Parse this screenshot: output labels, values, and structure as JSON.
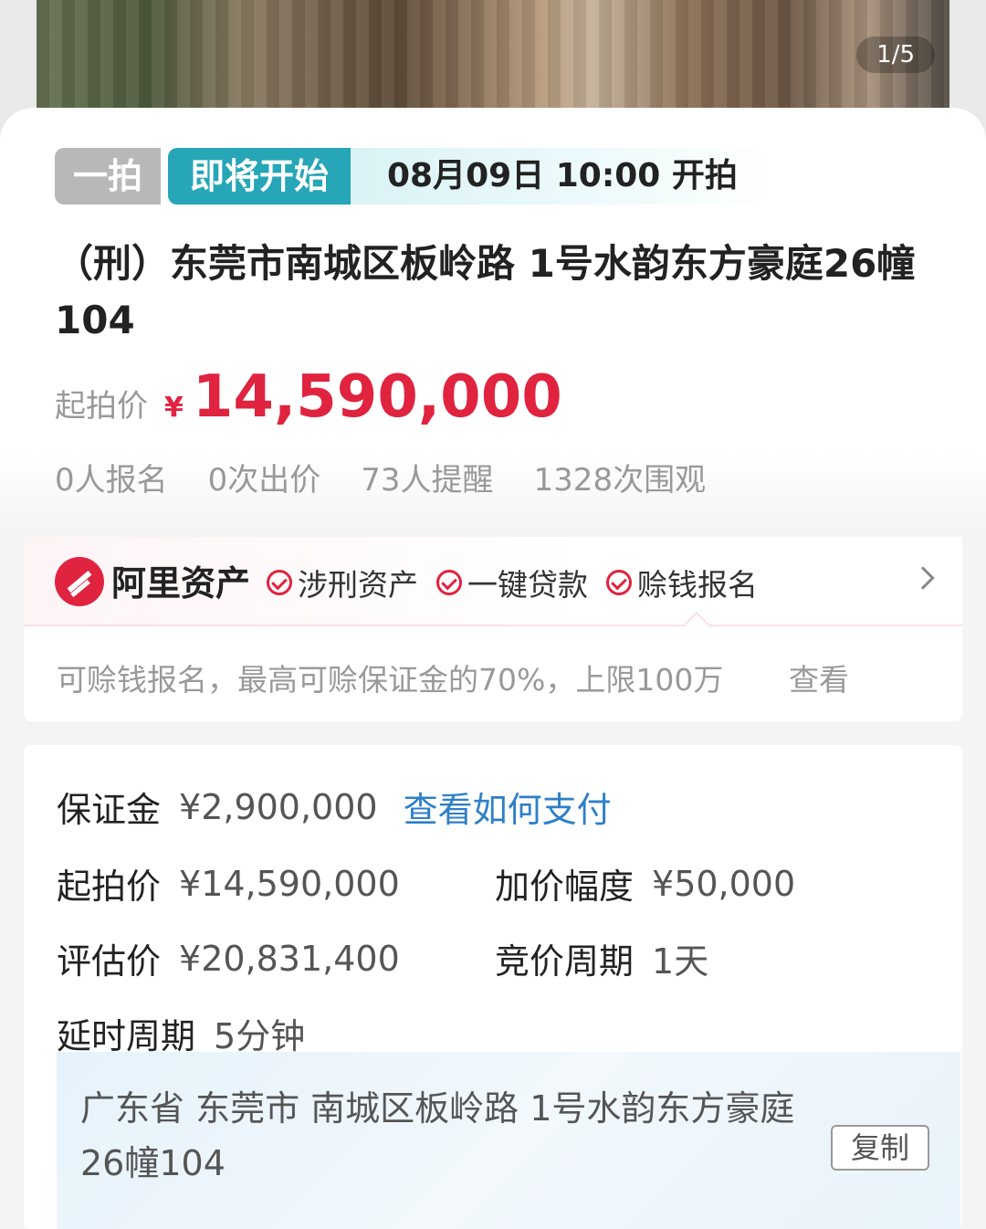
{
  "gallery": {
    "counter": "1/5"
  },
  "auction": {
    "round_tag": "一拍",
    "status_tag": "即将开始",
    "start_time": "08月09日 10:00  开拍",
    "title": "（刑）东莞市南城区板岭路 1号水韵东方豪庭26幢104",
    "start_price_label": "起拍价",
    "currency": "¥",
    "start_price": "14,590,000",
    "stats": [
      "0人报名",
      "0次出价",
      "73人提醒",
      "1328次围观"
    ]
  },
  "ali_assets": {
    "brand": "阿里资产",
    "tags": [
      "涉刑资产",
      "一键贷款",
      "赊钱报名"
    ],
    "note": "可赊钱报名，最高可赊保证金的70%，上限100万",
    "view_label": "查看"
  },
  "details": {
    "deposit_label": "保证金",
    "deposit_value": "¥2,900,000",
    "pay_link": "查看如何支付",
    "start_price_label": "起拍价",
    "start_price_value": "¥14,590,000",
    "increment_label": "加价幅度",
    "increment_value": "¥50,000",
    "appraisal_label": "评估价",
    "appraisal_value": "¥20,831,400",
    "cycle_label": "竞价周期",
    "cycle_value": "1天",
    "delay_label": "延时周期",
    "delay_value": "5分钟",
    "address": "广东省 东莞市 南城区板岭路 1号水韵东方豪庭26幢104",
    "copy_label": "复制"
  },
  "colors": {
    "accent_red": "#e0233f",
    "status_teal": "#26a6b7",
    "link_blue": "#2e7fc7"
  }
}
